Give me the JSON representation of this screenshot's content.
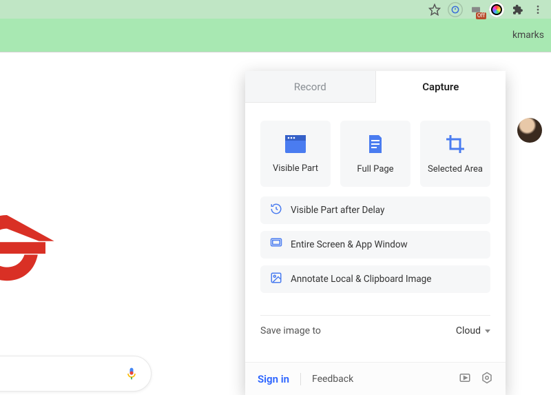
{
  "browser": {
    "bookmarks_label_partial": "kmarks",
    "ext_off_badge": "Off"
  },
  "popup": {
    "tabs": {
      "record": "Record",
      "capture": "Capture"
    },
    "cards": {
      "visible_part": "Visible Part",
      "full_page": "Full Page",
      "selected_area": "Selected Area"
    },
    "rows": {
      "visible_delay": "Visible Part after Delay",
      "entire_screen": "Entire Screen & App Window",
      "annotate_local": "Annotate Local & Clipboard Image"
    },
    "save": {
      "label": "Save image to",
      "destination": "Cloud"
    },
    "footer": {
      "signin": "Sign in",
      "feedback": "Feedback"
    }
  }
}
